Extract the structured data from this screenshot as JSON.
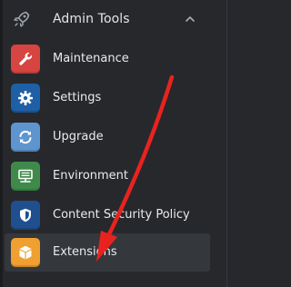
{
  "section": {
    "title": "Admin Tools",
    "icon": "rocket-icon",
    "toggle_icon": "chevron-up-icon"
  },
  "items": [
    {
      "label": "Maintenance",
      "icon": "wrench-icon",
      "color": "#d64541"
    },
    {
      "label": "Settings",
      "icon": "gear-icon",
      "color": "#1f5fa6"
    },
    {
      "label": "Upgrade",
      "icon": "refresh-icon",
      "color": "#5e95cf"
    },
    {
      "label": "Environment",
      "icon": "server-icon",
      "color": "#3f8a4a"
    },
    {
      "label": "Content Security Policy",
      "icon": "shield-icon",
      "color": "#1f4f8e"
    },
    {
      "label": "Extensions",
      "icon": "box-icon",
      "color": "#f0a030"
    }
  ],
  "colors": {
    "sidebar_bg": "#26282c",
    "active_row": "#34373c",
    "annotation_arrow": "#e8231f"
  },
  "annotation": {
    "type": "arrow",
    "points_to": "Extensions"
  }
}
